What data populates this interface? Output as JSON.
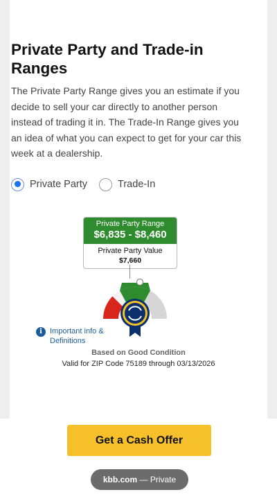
{
  "section": {
    "heading": "Private Party and Trade-in Ranges",
    "description": "The Private Party Range gives you an estimate if you decide to sell your car directly to another person instead of trading it in. The Trade-In Range gives you an idea of what you can expect to get for your car this week at a dealership."
  },
  "options": [
    {
      "label": "Private Party",
      "selected": true
    },
    {
      "label": "Trade-In",
      "selected": false
    }
  ],
  "range": {
    "title": "Private Party Range",
    "value": "$6,835 - $8,460",
    "value_label": "Private Party Value",
    "value_amount": "$7,660"
  },
  "gauge": {
    "icon": "kbb-badge-icon",
    "colors": {
      "left": "#d9261c",
      "center": "#2e8b2e",
      "right": "#d6d6d6",
      "badge": "#0b2f6b"
    }
  },
  "info": {
    "label": "Important info & Definitions",
    "icon": "info-icon"
  },
  "condition": "Based on Good Condition",
  "validity": "Valid for ZIP Code 75189 through 03/13/2026",
  "cta": {
    "label": "Get a Cash Offer",
    "color": "#f5c02a"
  },
  "browser": {
    "domain": "kbb.com",
    "mode": "— Private"
  }
}
